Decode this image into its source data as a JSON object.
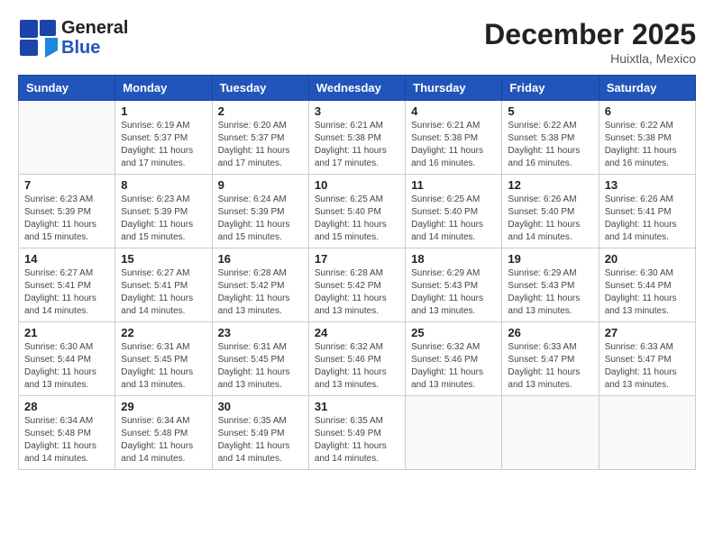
{
  "header": {
    "logo_general": "General",
    "logo_blue": "Blue",
    "month_title": "December 2025",
    "subtitle": "Huixtla, Mexico"
  },
  "days_of_week": [
    "Sunday",
    "Monday",
    "Tuesday",
    "Wednesday",
    "Thursday",
    "Friday",
    "Saturday"
  ],
  "weeks": [
    [
      {
        "day": "",
        "sunrise": "",
        "sunset": "",
        "daylight": ""
      },
      {
        "day": "1",
        "sunrise": "Sunrise: 6:19 AM",
        "sunset": "Sunset: 5:37 PM",
        "daylight": "Daylight: 11 hours and 17 minutes."
      },
      {
        "day": "2",
        "sunrise": "Sunrise: 6:20 AM",
        "sunset": "Sunset: 5:37 PM",
        "daylight": "Daylight: 11 hours and 17 minutes."
      },
      {
        "day": "3",
        "sunrise": "Sunrise: 6:21 AM",
        "sunset": "Sunset: 5:38 PM",
        "daylight": "Daylight: 11 hours and 17 minutes."
      },
      {
        "day": "4",
        "sunrise": "Sunrise: 6:21 AM",
        "sunset": "Sunset: 5:38 PM",
        "daylight": "Daylight: 11 hours and 16 minutes."
      },
      {
        "day": "5",
        "sunrise": "Sunrise: 6:22 AM",
        "sunset": "Sunset: 5:38 PM",
        "daylight": "Daylight: 11 hours and 16 minutes."
      },
      {
        "day": "6",
        "sunrise": "Sunrise: 6:22 AM",
        "sunset": "Sunset: 5:38 PM",
        "daylight": "Daylight: 11 hours and 16 minutes."
      }
    ],
    [
      {
        "day": "7",
        "sunrise": "Sunrise: 6:23 AM",
        "sunset": "Sunset: 5:39 PM",
        "daylight": "Daylight: 11 hours and 15 minutes."
      },
      {
        "day": "8",
        "sunrise": "Sunrise: 6:23 AM",
        "sunset": "Sunset: 5:39 PM",
        "daylight": "Daylight: 11 hours and 15 minutes."
      },
      {
        "day": "9",
        "sunrise": "Sunrise: 6:24 AM",
        "sunset": "Sunset: 5:39 PM",
        "daylight": "Daylight: 11 hours and 15 minutes."
      },
      {
        "day": "10",
        "sunrise": "Sunrise: 6:25 AM",
        "sunset": "Sunset: 5:40 PM",
        "daylight": "Daylight: 11 hours and 15 minutes."
      },
      {
        "day": "11",
        "sunrise": "Sunrise: 6:25 AM",
        "sunset": "Sunset: 5:40 PM",
        "daylight": "Daylight: 11 hours and 14 minutes."
      },
      {
        "day": "12",
        "sunrise": "Sunrise: 6:26 AM",
        "sunset": "Sunset: 5:40 PM",
        "daylight": "Daylight: 11 hours and 14 minutes."
      },
      {
        "day": "13",
        "sunrise": "Sunrise: 6:26 AM",
        "sunset": "Sunset: 5:41 PM",
        "daylight": "Daylight: 11 hours and 14 minutes."
      }
    ],
    [
      {
        "day": "14",
        "sunrise": "Sunrise: 6:27 AM",
        "sunset": "Sunset: 5:41 PM",
        "daylight": "Daylight: 11 hours and 14 minutes."
      },
      {
        "day": "15",
        "sunrise": "Sunrise: 6:27 AM",
        "sunset": "Sunset: 5:41 PM",
        "daylight": "Daylight: 11 hours and 14 minutes."
      },
      {
        "day": "16",
        "sunrise": "Sunrise: 6:28 AM",
        "sunset": "Sunset: 5:42 PM",
        "daylight": "Daylight: 11 hours and 13 minutes."
      },
      {
        "day": "17",
        "sunrise": "Sunrise: 6:28 AM",
        "sunset": "Sunset: 5:42 PM",
        "daylight": "Daylight: 11 hours and 13 minutes."
      },
      {
        "day": "18",
        "sunrise": "Sunrise: 6:29 AM",
        "sunset": "Sunset: 5:43 PM",
        "daylight": "Daylight: 11 hours and 13 minutes."
      },
      {
        "day": "19",
        "sunrise": "Sunrise: 6:29 AM",
        "sunset": "Sunset: 5:43 PM",
        "daylight": "Daylight: 11 hours and 13 minutes."
      },
      {
        "day": "20",
        "sunrise": "Sunrise: 6:30 AM",
        "sunset": "Sunset: 5:44 PM",
        "daylight": "Daylight: 11 hours and 13 minutes."
      }
    ],
    [
      {
        "day": "21",
        "sunrise": "Sunrise: 6:30 AM",
        "sunset": "Sunset: 5:44 PM",
        "daylight": "Daylight: 11 hours and 13 minutes."
      },
      {
        "day": "22",
        "sunrise": "Sunrise: 6:31 AM",
        "sunset": "Sunset: 5:45 PM",
        "daylight": "Daylight: 11 hours and 13 minutes."
      },
      {
        "day": "23",
        "sunrise": "Sunrise: 6:31 AM",
        "sunset": "Sunset: 5:45 PM",
        "daylight": "Daylight: 11 hours and 13 minutes."
      },
      {
        "day": "24",
        "sunrise": "Sunrise: 6:32 AM",
        "sunset": "Sunset: 5:46 PM",
        "daylight": "Daylight: 11 hours and 13 minutes."
      },
      {
        "day": "25",
        "sunrise": "Sunrise: 6:32 AM",
        "sunset": "Sunset: 5:46 PM",
        "daylight": "Daylight: 11 hours and 13 minutes."
      },
      {
        "day": "26",
        "sunrise": "Sunrise: 6:33 AM",
        "sunset": "Sunset: 5:47 PM",
        "daylight": "Daylight: 11 hours and 13 minutes."
      },
      {
        "day": "27",
        "sunrise": "Sunrise: 6:33 AM",
        "sunset": "Sunset: 5:47 PM",
        "daylight": "Daylight: 11 hours and 13 minutes."
      }
    ],
    [
      {
        "day": "28",
        "sunrise": "Sunrise: 6:34 AM",
        "sunset": "Sunset: 5:48 PM",
        "daylight": "Daylight: 11 hours and 14 minutes."
      },
      {
        "day": "29",
        "sunrise": "Sunrise: 6:34 AM",
        "sunset": "Sunset: 5:48 PM",
        "daylight": "Daylight: 11 hours and 14 minutes."
      },
      {
        "day": "30",
        "sunrise": "Sunrise: 6:35 AM",
        "sunset": "Sunset: 5:49 PM",
        "daylight": "Daylight: 11 hours and 14 minutes."
      },
      {
        "day": "31",
        "sunrise": "Sunrise: 6:35 AM",
        "sunset": "Sunset: 5:49 PM",
        "daylight": "Daylight: 11 hours and 14 minutes."
      },
      {
        "day": "",
        "sunrise": "",
        "sunset": "",
        "daylight": ""
      },
      {
        "day": "",
        "sunrise": "",
        "sunset": "",
        "daylight": ""
      },
      {
        "day": "",
        "sunrise": "",
        "sunset": "",
        "daylight": ""
      }
    ]
  ]
}
